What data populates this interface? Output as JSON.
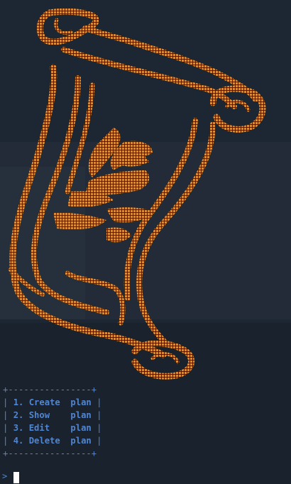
{
  "art": {
    "color": "#d98a3a",
    "icon": "scroll-icon"
  },
  "menu": {
    "border": "+----------------+",
    "options": [
      "1. Create  plan",
      "2. Show    plan",
      "3. Edit    plan",
      "4. Delete  plan"
    ]
  },
  "prompt": {
    "symbol": ">"
  },
  "colors": {
    "background": "#1d2633",
    "menu_text": "#4f86d4",
    "cursor": "#ffffff"
  }
}
